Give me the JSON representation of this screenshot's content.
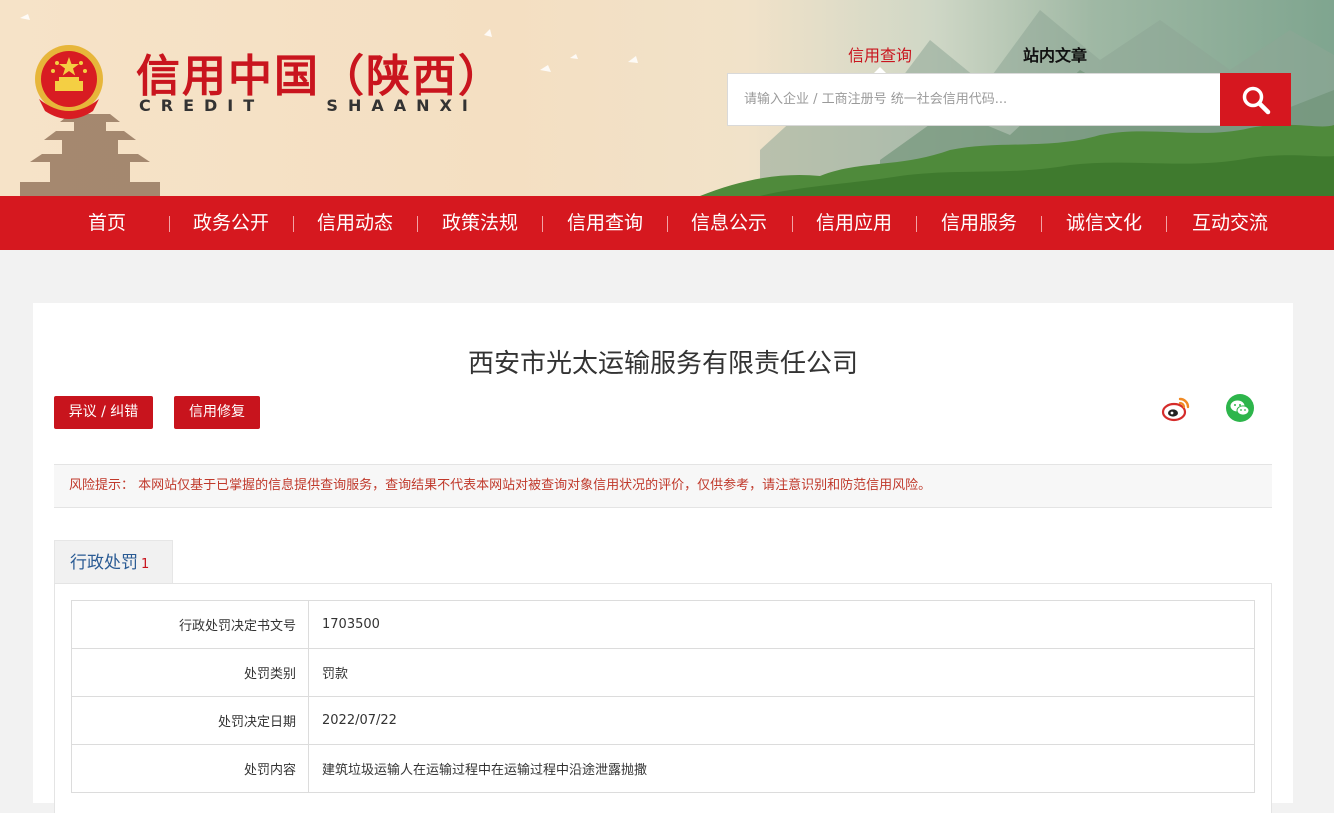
{
  "header": {
    "title": "信用中国（陕西）",
    "subtitle": "CREDIT    SHAANXI",
    "search_tabs": [
      "信用查询",
      "站内文章"
    ],
    "search_placeholder": "请输入企业 / 工商注册号 统一社会信用代码..."
  },
  "nav": {
    "items": [
      "首页",
      "政务公开",
      "信用动态",
      "政策法规",
      "信用查询",
      "信息公示",
      "信用应用",
      "信用服务",
      "诚信文化",
      "互动交流"
    ]
  },
  "company": {
    "name": "西安市光太运输服务有限责任公司",
    "btn_objection": "异议 / 纠错",
    "btn_repair": "信用修复"
  },
  "share": {
    "icons": [
      "weibo-icon",
      "wechat-icon"
    ]
  },
  "risk_notice": "风险提示： 本网站仅基于已掌握的信息提供查询服务，查询结果不代表本网站对被查询对象信用状况的评价，仅供参考，请注意识别和防范信用风险。",
  "tab": {
    "label": "行政处罚",
    "count": "1"
  },
  "penalty": {
    "rows": [
      {
        "key": "行政处罚决定书文号",
        "value": "1703500"
      },
      {
        "key": "处罚类别",
        "value": "罚款"
      },
      {
        "key": "处罚决定日期",
        "value": "2022/07/22"
      },
      {
        "key": "处罚内容",
        "value": "建筑垃圾运输人在运输过程中在运输过程中沿途泄露抛撒"
      }
    ]
  },
  "colors": {
    "brand_red": "#d6181f",
    "button_red": "#c8141d",
    "link_blue": "#2a5b94"
  }
}
